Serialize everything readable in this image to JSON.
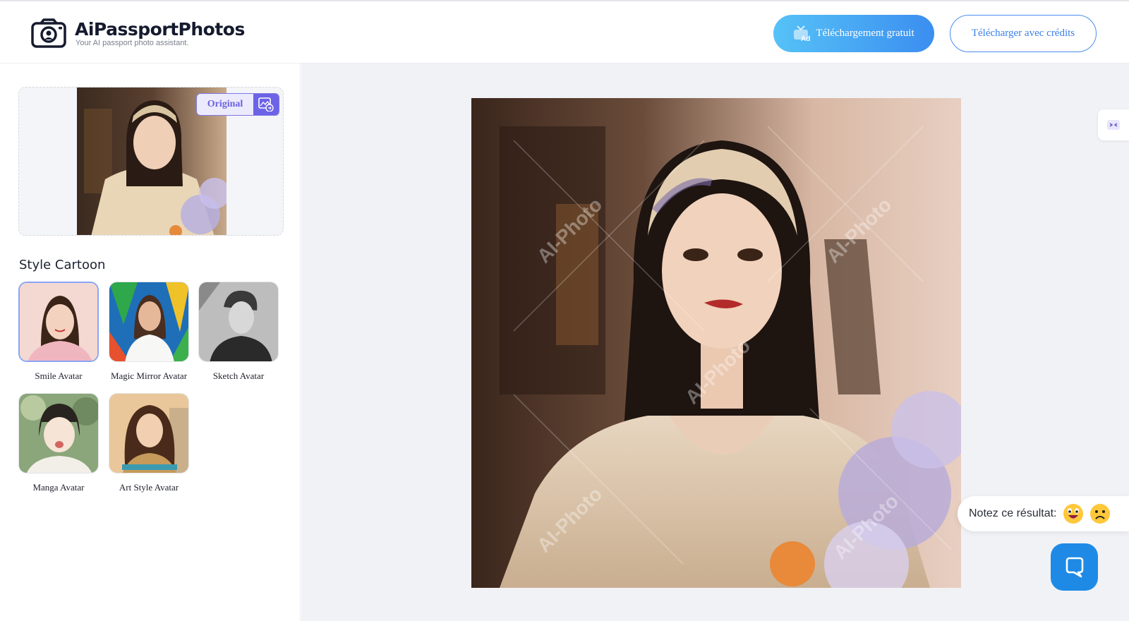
{
  "header": {
    "logo_title": "AiPassportPhotos",
    "logo_subtitle": "Your AI passport photo assistant.",
    "free_download_label": "Téléchargement gratuit",
    "ad_badge": "Ad",
    "credits_download_label": "Télécharger avec crédits"
  },
  "sidebar": {
    "original_label": "Original",
    "style_title": "Style Cartoon",
    "styles": [
      {
        "label": "Smile Avatar",
        "selected": true
      },
      {
        "label": "Magic Mirror Avatar",
        "selected": false
      },
      {
        "label": "Sketch Avatar",
        "selected": false
      },
      {
        "label": "Manga Avatar",
        "selected": false
      },
      {
        "label": "Art Style Avatar",
        "selected": false
      }
    ]
  },
  "main": {
    "watermark": "AI-Photo",
    "rate_label": "Notez ce résultat:"
  },
  "colors": {
    "accent_blue": "#3b8ef0",
    "accent_purple": "#6c63e6",
    "chat_blue": "#1e8ae6",
    "main_bg": "#f1f2f6"
  },
  "icons": [
    "camera-logo-icon",
    "tv-ad-icon",
    "image-swap-icon",
    "collapse-icon",
    "happy-emoji-icon",
    "sad-emoji-icon",
    "chat-bubble-icon"
  ]
}
